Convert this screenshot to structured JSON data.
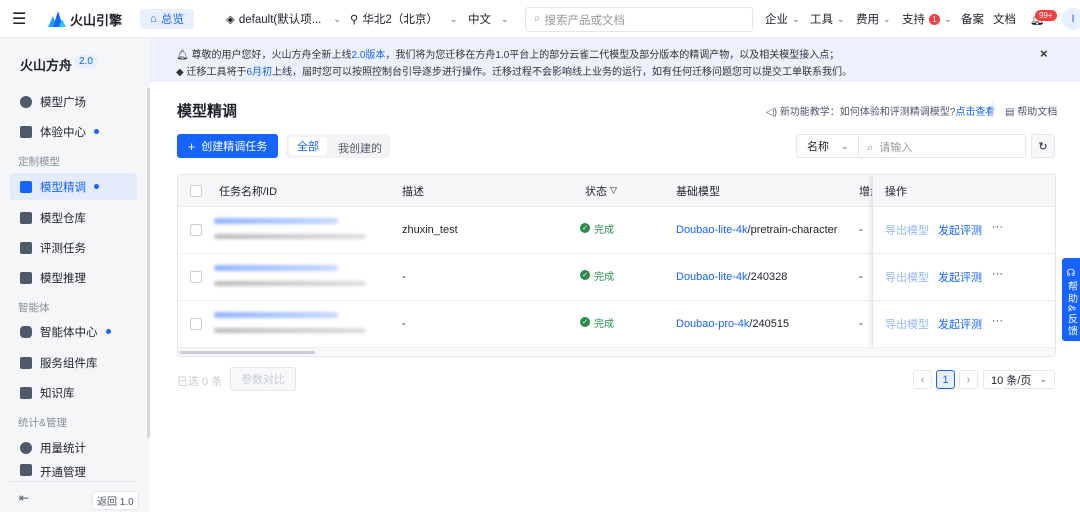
{
  "topbar": {
    "brand": "火山引擎",
    "home": "总览",
    "project": "default(默认项...",
    "region": "华北2（北京）",
    "lang": "中文",
    "search_placeholder": "搜索产品或文档",
    "nav": [
      "企业",
      "工具",
      "费用",
      "支持"
    ],
    "support_badge": "1",
    "beian": "备案",
    "docs": "文档",
    "bell_badge": "99+",
    "avatar": "I"
  },
  "sidebar": {
    "title": "火山方舟",
    "version": "2.0",
    "items": [
      "模型广场",
      "体验中心",
      "模型精调",
      "模型仓库",
      "评测任务",
      "模型推理",
      "智能体中心",
      "服务组件库",
      "知识库",
      "用量统计",
      "开通管理"
    ],
    "sections": [
      "定制模型",
      "智能体",
      "统计&管理"
    ],
    "back": "返回 1.0"
  },
  "banner": {
    "l1a": "尊敬的用户您好，火山方舟全新上线",
    "l1link": "2.0版本",
    "l1b": "，我们将为您迁移在方舟1.0平台上的部分云雀二代模型及部分版本的精调产物，以及相关模型接入点；",
    "l2a": "迁移工具将于",
    "l2link": "6月初",
    "l2b": "上线，届时您可以按照控制台引导逐步进行操作。迁移过程不会影响线上业务的运行，如有任何迁移问题您可以提交工单联系我们。",
    "close": "×"
  },
  "main": {
    "title": "模型精调",
    "tutorial": "新功能教学：如何体验和评测精调模型?",
    "tutorial_link": "点击查看",
    "help_docs": "帮助文档",
    "create": "创建精调任务",
    "tabs": [
      "全部",
      "我创建的"
    ],
    "filter_field": "名称",
    "search_placeholder": "请输入",
    "columns": [
      "任务名称/ID",
      "描述",
      "状态",
      "基础模型",
      "增量",
      "操作"
    ],
    "rows": [
      {
        "desc": "zhuxin_test",
        "status": "完成",
        "model": "Doubao-lite-4k",
        "version": "/pretrain-character",
        "inc": "-"
      },
      {
        "desc": "-",
        "status": "完成",
        "model": "Doubao-lite-4k",
        "version": "/240328",
        "inc": "-"
      },
      {
        "desc": "-",
        "status": "完成",
        "model": "Doubao-pro-4k",
        "version": "/240515",
        "inc": "-"
      }
    ],
    "actions": {
      "export": "导出模型",
      "evaluate": "发起评测",
      "more": "···"
    },
    "selected": "已选 0 条",
    "compare": "参数对比",
    "page": "1",
    "page_size": "10 条/页"
  },
  "float_help": "帮助&反馈"
}
